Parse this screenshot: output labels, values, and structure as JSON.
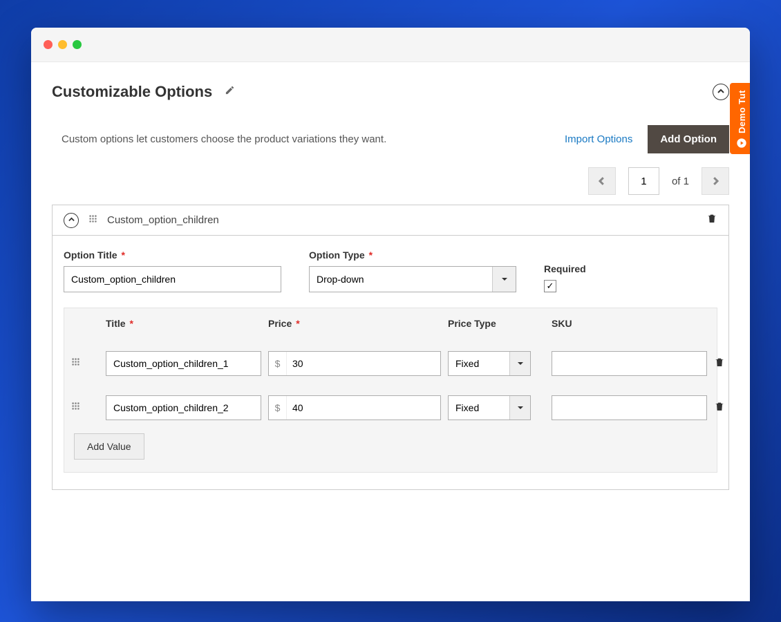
{
  "section": {
    "title": "Customizable Options"
  },
  "subheader": {
    "text": "Custom options let customers choose the product variations they want.",
    "import_label": "Import Options",
    "add_label": "Add Option"
  },
  "pager": {
    "current": "1",
    "of_label": "of",
    "total": "1"
  },
  "option": {
    "name": "Custom_option_children",
    "title_label": "Option Title",
    "title_value": "Custom_option_children",
    "type_label": "Option Type",
    "type_value": "Drop-down",
    "required_label": "Required",
    "required_checked": "✓"
  },
  "values_table": {
    "headers": {
      "title": "Title",
      "price": "Price",
      "price_type": "Price Type",
      "sku": "SKU"
    },
    "currency": "$",
    "rows": [
      {
        "title": "Custom_option_children_1",
        "price": "30",
        "price_type": "Fixed",
        "sku": ""
      },
      {
        "title": "Custom_option_children_2",
        "price": "40",
        "price_type": "Fixed",
        "sku": ""
      }
    ],
    "add_value_label": "Add Value"
  },
  "demo_tab": {
    "label": "Demo Tut"
  }
}
